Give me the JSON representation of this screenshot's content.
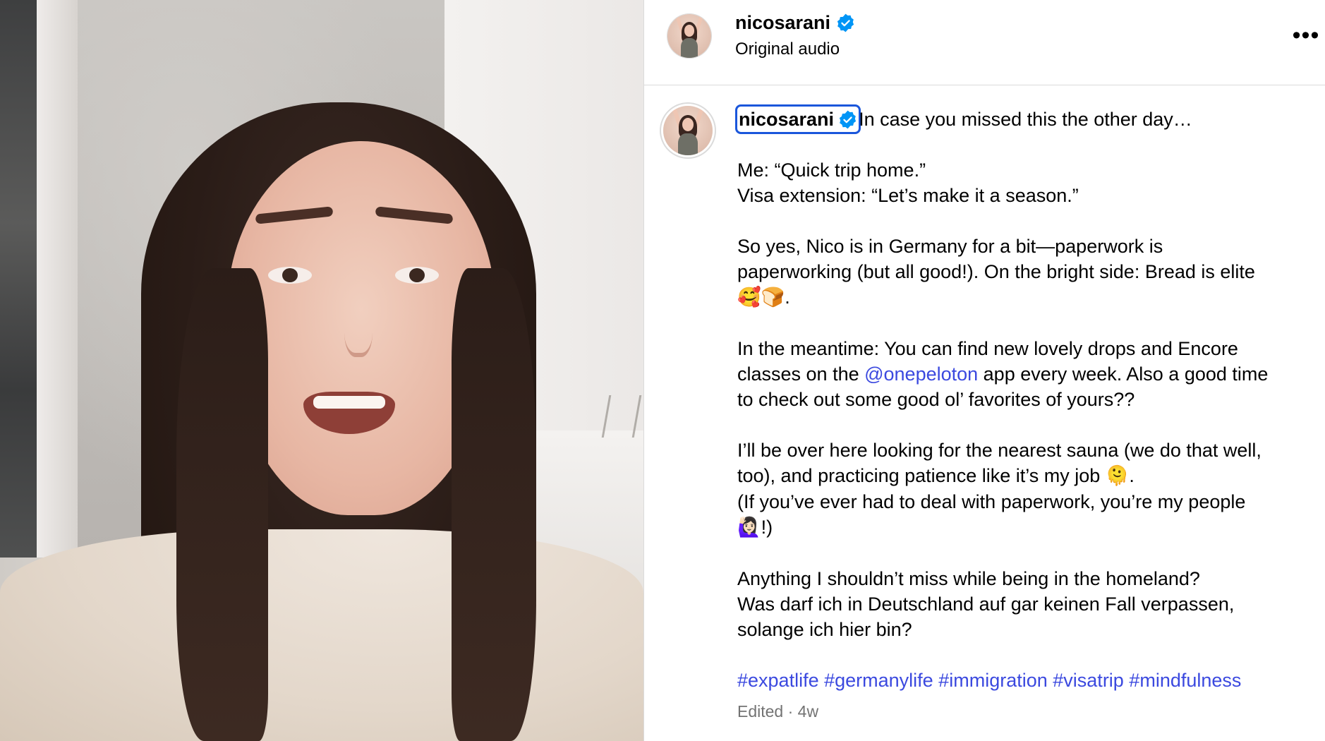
{
  "header": {
    "username": "nicosarani",
    "subtitle": "Original audio",
    "more_label": "•••"
  },
  "caption": {
    "username": "nicosarani",
    "first_line": "In case you missed this the other day…",
    "p2_l1": "Me: “Quick trip home.”",
    "p2_l2": "Visa extension: “Let’s make it a season.”",
    "p3_l1": "So yes, Nico is in Germany for a bit—paperwork is",
    "p3_l2": "paperworking (but all good!). On the bright side: Bread is elite",
    "p3_emoji": "🥰🍞",
    "p3_end": ".",
    "p4_l1": "In the meantime: You can find new lovely drops and Encore",
    "p4_l2_pre": "classes on the ",
    "p4_mention": "@onepeloton",
    "p4_l2_post": " app every week. Also a good time",
    "p4_l3": "to check out some good ol’ favorites of yours??",
    "p5_l1": "I’ll be over here looking for the nearest sauna (we do that well,",
    "p5_l2": "too), and practicing patience like it’s my job ",
    "p5_emoji1": "🫠",
    "p5_l2_end": ".",
    "p5_l3": "(If you’ve ever had to deal with paperwork, you’re my people",
    "p5_emoji2": "🙋🏻‍♀️",
    "p5_l4_end": "!)",
    "p6_l1": "Anything I shouldn’t miss while being in the homeland?",
    "p6_l2": "Was darf ich in Deutschland auf gar keinen Fall verpassen,",
    "p6_l3": "solange ich hier bin?",
    "hashtags": [
      "#expatlife",
      "#germanylife",
      "#immigration",
      "#visatrip",
      "#mindfulness"
    ]
  },
  "meta": "Edited · 4w",
  "icons": {
    "verified": "verified-badge-icon",
    "more": "more-options-icon"
  },
  "colors": {
    "link": "#3b49df",
    "verified": "#0095f6",
    "secondary_text": "#737373",
    "focus_outline": "#1a56db"
  }
}
